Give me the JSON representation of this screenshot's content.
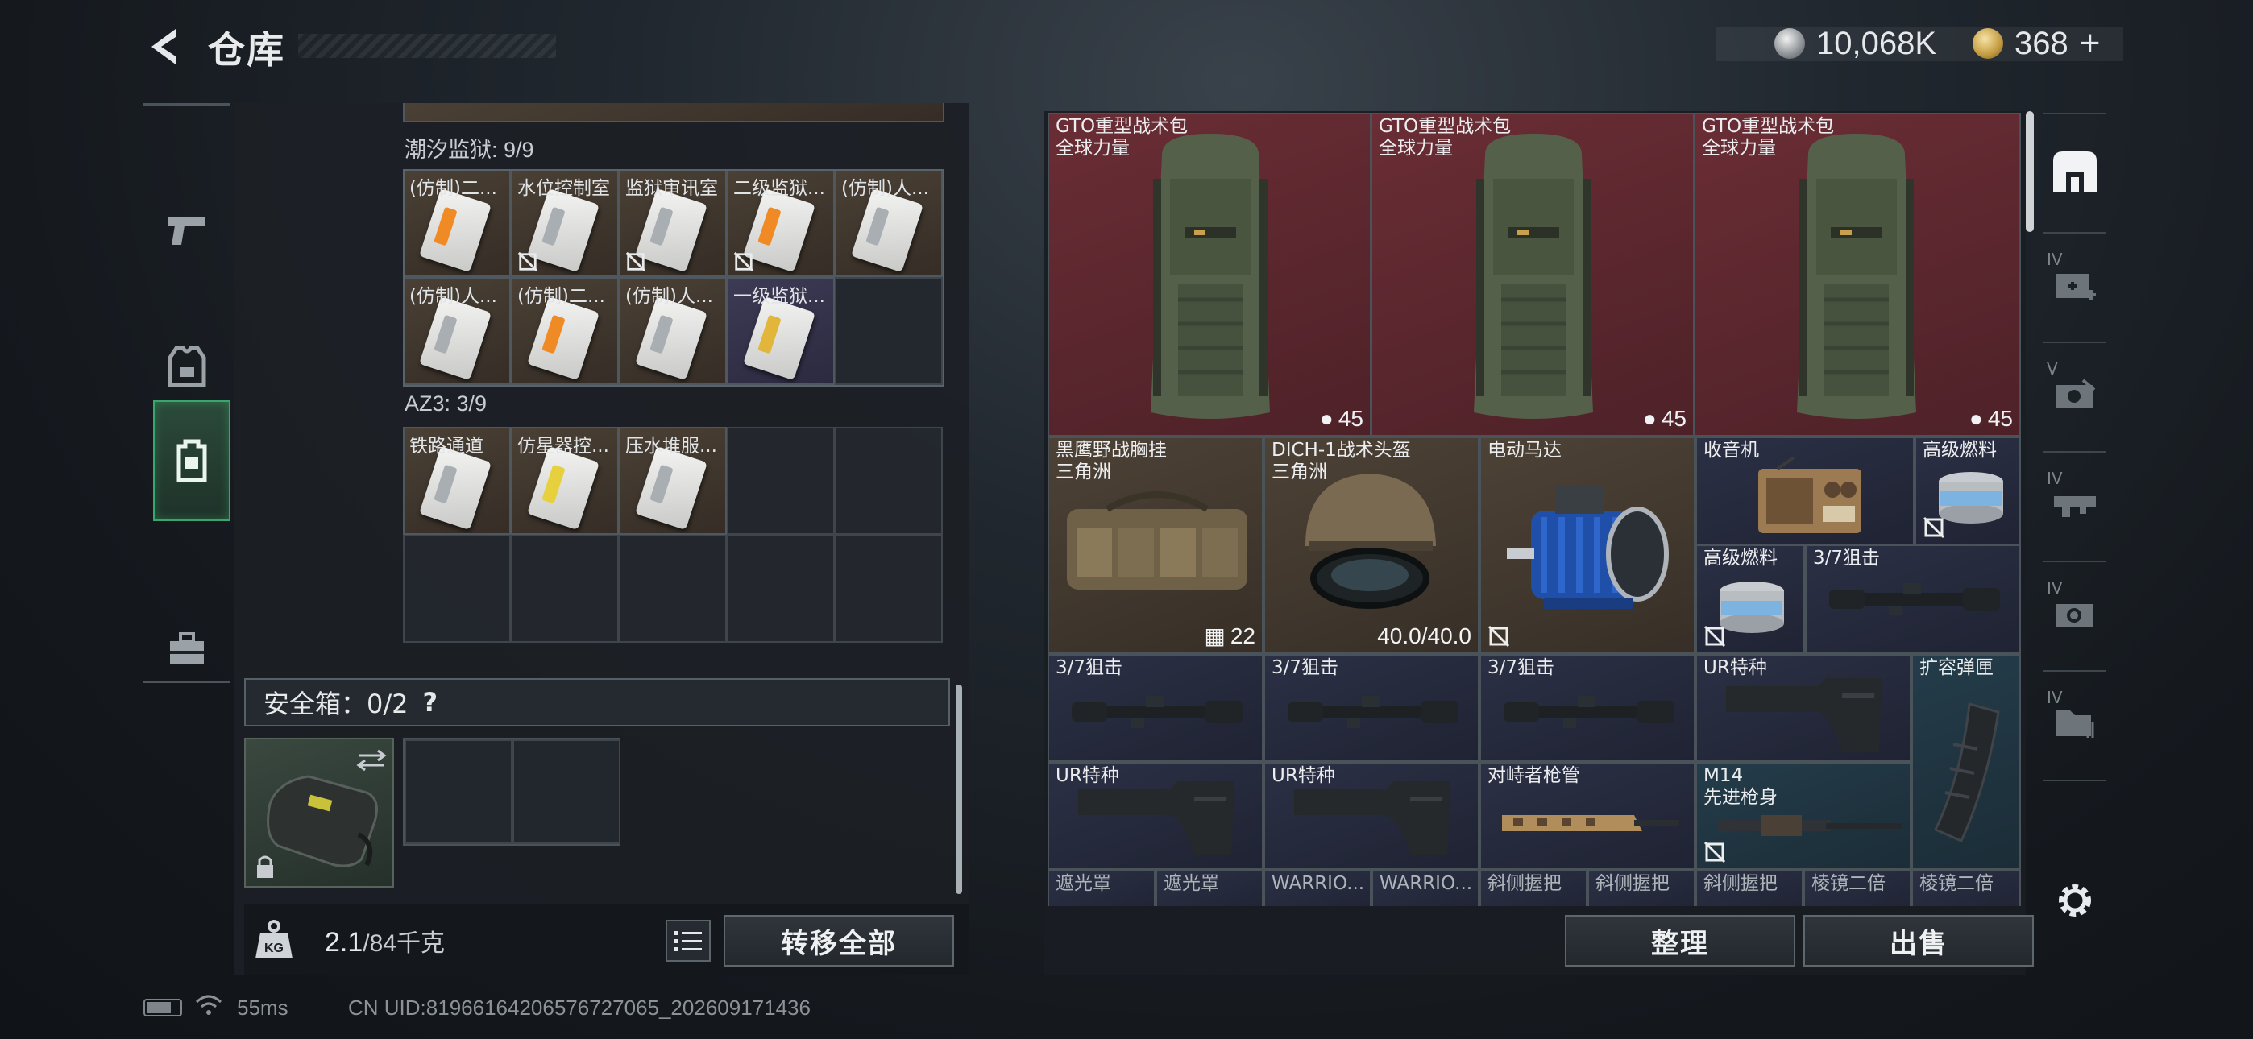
{
  "header": {
    "title": "仓库",
    "currency": [
      {
        "icon": "silver-coin-icon",
        "value": "10,068K"
      },
      {
        "icon": "gold-coin-icon",
        "value": "368"
      }
    ],
    "add": "+"
  },
  "left_nav": [
    {
      "icon": "pistol-icon"
    },
    {
      "icon": "armor-vest-icon"
    },
    {
      "icon": "backpack-icon",
      "active": true
    },
    {
      "icon": "toolbox-icon"
    }
  ],
  "sections": [
    {
      "label": "潮汐监狱: 9/9",
      "items": [
        {
          "name": "(仿制)二...",
          "color": "#f08a24",
          "nocopy": false
        },
        {
          "name": "水位控制室",
          "color": "#a9aeb3",
          "nocopy": true
        },
        {
          "name": "监狱审讯室",
          "color": "#a9aeb3",
          "nocopy": true
        },
        {
          "name": "二级监狱...",
          "color": "#f08a24",
          "nocopy": true
        },
        {
          "name": "(仿制)人...",
          "color": "#a9aeb3",
          "nocopy": false
        },
        {
          "name": "(仿制)人...",
          "color": "#a9aeb3",
          "nocopy": false
        },
        {
          "name": "(仿制)二...",
          "color": "#f08a24",
          "nocopy": false
        },
        {
          "name": "(仿制)人...",
          "color": "#a9aeb3",
          "nocopy": false
        },
        {
          "name": "一级监狱...",
          "color": "#e2b63a",
          "nocopy": false
        }
      ]
    },
    {
      "label": "AZ3: 3/9",
      "items": [
        {
          "name": "铁路通道",
          "color": "#a9aeb3"
        },
        {
          "name": "仿星器控...",
          "color": "#e7d03d"
        },
        {
          "name": "压水堆服...",
          "color": "#a9aeb3"
        }
      ]
    }
  ],
  "safe": {
    "label": "安全箱：0/2",
    "help": "?"
  },
  "weight": {
    "current": "2.1",
    "max": "/84千克"
  },
  "buttons": {
    "transfer_all": "转移全部",
    "organize": "整理",
    "sell": "出售"
  },
  "stash": {
    "backpacks": [
      {
        "name": "GTO重型战术包",
        "sub": "全球力量",
        "count": "45"
      },
      {
        "name": "GTO重型战术包",
        "sub": "全球力量",
        "count": "45"
      },
      {
        "name": "GTO重型战术包",
        "sub": "全球力量",
        "count": "45"
      }
    ],
    "vest": {
      "name": "黑鹰野战胸挂",
      "sub": "三角洲",
      "count": "22"
    },
    "helmet": {
      "name": "DICH-1战术头盔",
      "sub": "三角洲",
      "durability": "40.0/40.0"
    },
    "motor": {
      "name": "电动马达"
    },
    "radio": {
      "name": "收音机"
    },
    "fuel1": {
      "name": "高级燃料"
    },
    "fuel2": {
      "name": "高级燃料"
    },
    "scope_top": {
      "name": "3/7狙击"
    },
    "scopes": [
      "3/7狙击",
      "3/7狙击",
      "3/7狙击"
    ],
    "stock1": {
      "name": "UR特种"
    },
    "mag": {
      "name": "扩容弹匣"
    },
    "stocks": [
      "UR特种",
      "UR特种"
    ],
    "handguard": {
      "name": "对峙者枪管"
    },
    "barrel": {
      "name": "M14",
      "sub": "先进枪身"
    },
    "bottom_labels": [
      "遮光罩",
      "遮光罩",
      "WARRIO...",
      "WARRIO...",
      "斜侧握把",
      "斜侧握把",
      "斜侧握把",
      "棱镜二倍",
      "棱镜二倍"
    ]
  },
  "right_nav": [
    {
      "tag": ""
    },
    {
      "tag": "IV"
    },
    {
      "tag": "V"
    },
    {
      "tag": "IV"
    },
    {
      "tag": "IV"
    },
    {
      "tag": "IV"
    }
  ],
  "status": {
    "ping": "55ms",
    "uid": "CN UID:81966164206576727065_202609171436"
  }
}
